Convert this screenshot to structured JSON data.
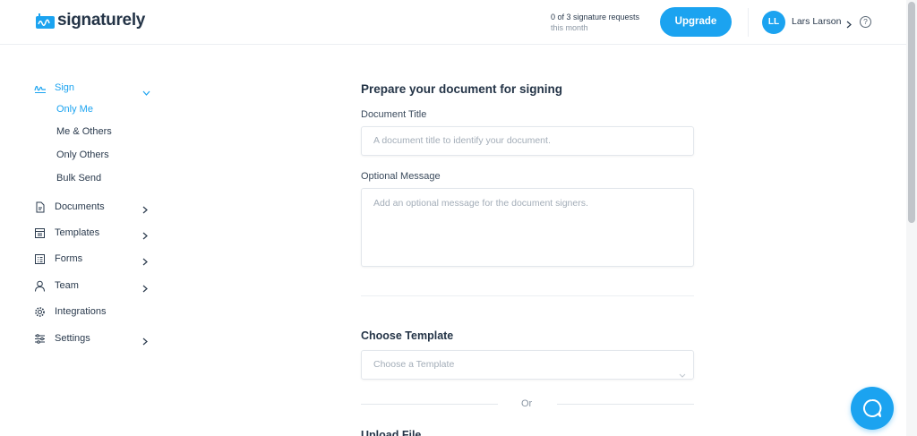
{
  "header": {
    "brand": "signaturely",
    "requests_count": "0 of 3 signature requests",
    "requests_period": "this month",
    "upgrade_label": "Upgrade",
    "user_initials": "LL",
    "user_name": "Lars Larson",
    "help_label": "?"
  },
  "sidebar": {
    "sign": {
      "label": "Sign",
      "sub_items": [
        "Only Me",
        "Me & Others",
        "Only Others",
        "Bulk Send"
      ]
    },
    "items": [
      {
        "label": "Documents"
      },
      {
        "label": "Templates"
      },
      {
        "label": "Forms"
      },
      {
        "label": "Team"
      },
      {
        "label": "Integrations"
      },
      {
        "label": "Settings"
      }
    ]
  },
  "main": {
    "title": "Prepare your document for signing",
    "document_title_label": "Document Title",
    "document_title_placeholder": "A document title to identify your document.",
    "message_label": "Optional Message",
    "message_placeholder": "Add an optional message for the document signers.",
    "choose_template_title": "Choose Template",
    "template_placeholder": "Choose a Template",
    "or_text": "Or",
    "upload_title": "Upload File"
  },
  "colors": {
    "accent": "#1ba3f0",
    "text": "#243447",
    "muted": "#a3adb8"
  },
  "icons": {
    "logo": "signature-logo-icon",
    "sign": "signature-icon",
    "documents": "document-icon",
    "templates": "template-icon",
    "forms": "form-icon",
    "team": "person-icon",
    "integrations": "gear-icon",
    "settings": "sliders-icon",
    "chat": "chat-icon"
  }
}
